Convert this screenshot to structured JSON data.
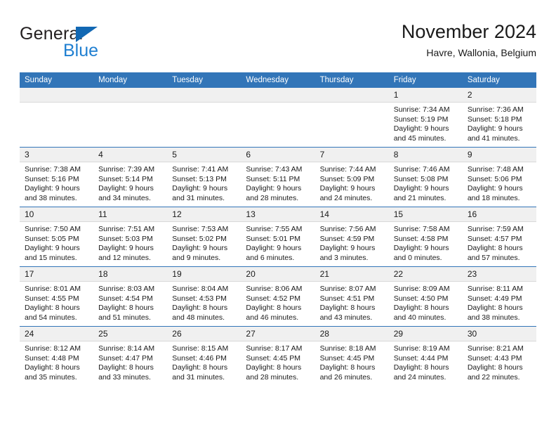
{
  "brand": {
    "name_part1": "General",
    "name_part2": "Blue",
    "triangle_color": "#1268b3",
    "blue_color": "#1f7fd1"
  },
  "header": {
    "title": "November 2024",
    "subtitle": "Havre, Wallonia, Belgium",
    "header_bg": "#3275b8",
    "daynum_bg": "#f0f0f0"
  },
  "weekdays": [
    "Sunday",
    "Monday",
    "Tuesday",
    "Wednesday",
    "Thursday",
    "Friday",
    "Saturday"
  ],
  "weeks": [
    [
      {
        "day": "",
        "empty": true
      },
      {
        "day": "",
        "empty": true
      },
      {
        "day": "",
        "empty": true
      },
      {
        "day": "",
        "empty": true
      },
      {
        "day": "",
        "empty": true
      },
      {
        "day": "1",
        "sunrise": "Sunrise: 7:34 AM",
        "sunset": "Sunset: 5:19 PM",
        "daylight1": "Daylight: 9 hours",
        "daylight2": "and 45 minutes."
      },
      {
        "day": "2",
        "sunrise": "Sunrise: 7:36 AM",
        "sunset": "Sunset: 5:18 PM",
        "daylight1": "Daylight: 9 hours",
        "daylight2": "and 41 minutes."
      }
    ],
    [
      {
        "day": "3",
        "sunrise": "Sunrise: 7:38 AM",
        "sunset": "Sunset: 5:16 PM",
        "daylight1": "Daylight: 9 hours",
        "daylight2": "and 38 minutes."
      },
      {
        "day": "4",
        "sunrise": "Sunrise: 7:39 AM",
        "sunset": "Sunset: 5:14 PM",
        "daylight1": "Daylight: 9 hours",
        "daylight2": "and 34 minutes."
      },
      {
        "day": "5",
        "sunrise": "Sunrise: 7:41 AM",
        "sunset": "Sunset: 5:13 PM",
        "daylight1": "Daylight: 9 hours",
        "daylight2": "and 31 minutes."
      },
      {
        "day": "6",
        "sunrise": "Sunrise: 7:43 AM",
        "sunset": "Sunset: 5:11 PM",
        "daylight1": "Daylight: 9 hours",
        "daylight2": "and 28 minutes."
      },
      {
        "day": "7",
        "sunrise": "Sunrise: 7:44 AM",
        "sunset": "Sunset: 5:09 PM",
        "daylight1": "Daylight: 9 hours",
        "daylight2": "and 24 minutes."
      },
      {
        "day": "8",
        "sunrise": "Sunrise: 7:46 AM",
        "sunset": "Sunset: 5:08 PM",
        "daylight1": "Daylight: 9 hours",
        "daylight2": "and 21 minutes."
      },
      {
        "day": "9",
        "sunrise": "Sunrise: 7:48 AM",
        "sunset": "Sunset: 5:06 PM",
        "daylight1": "Daylight: 9 hours",
        "daylight2": "and 18 minutes."
      }
    ],
    [
      {
        "day": "10",
        "sunrise": "Sunrise: 7:50 AM",
        "sunset": "Sunset: 5:05 PM",
        "daylight1": "Daylight: 9 hours",
        "daylight2": "and 15 minutes."
      },
      {
        "day": "11",
        "sunrise": "Sunrise: 7:51 AM",
        "sunset": "Sunset: 5:03 PM",
        "daylight1": "Daylight: 9 hours",
        "daylight2": "and 12 minutes."
      },
      {
        "day": "12",
        "sunrise": "Sunrise: 7:53 AM",
        "sunset": "Sunset: 5:02 PM",
        "daylight1": "Daylight: 9 hours",
        "daylight2": "and 9 minutes."
      },
      {
        "day": "13",
        "sunrise": "Sunrise: 7:55 AM",
        "sunset": "Sunset: 5:01 PM",
        "daylight1": "Daylight: 9 hours",
        "daylight2": "and 6 minutes."
      },
      {
        "day": "14",
        "sunrise": "Sunrise: 7:56 AM",
        "sunset": "Sunset: 4:59 PM",
        "daylight1": "Daylight: 9 hours",
        "daylight2": "and 3 minutes."
      },
      {
        "day": "15",
        "sunrise": "Sunrise: 7:58 AM",
        "sunset": "Sunset: 4:58 PM",
        "daylight1": "Daylight: 9 hours",
        "daylight2": "and 0 minutes."
      },
      {
        "day": "16",
        "sunrise": "Sunrise: 7:59 AM",
        "sunset": "Sunset: 4:57 PM",
        "daylight1": "Daylight: 8 hours",
        "daylight2": "and 57 minutes."
      }
    ],
    [
      {
        "day": "17",
        "sunrise": "Sunrise: 8:01 AM",
        "sunset": "Sunset: 4:55 PM",
        "daylight1": "Daylight: 8 hours",
        "daylight2": "and 54 minutes."
      },
      {
        "day": "18",
        "sunrise": "Sunrise: 8:03 AM",
        "sunset": "Sunset: 4:54 PM",
        "daylight1": "Daylight: 8 hours",
        "daylight2": "and 51 minutes."
      },
      {
        "day": "19",
        "sunrise": "Sunrise: 8:04 AM",
        "sunset": "Sunset: 4:53 PM",
        "daylight1": "Daylight: 8 hours",
        "daylight2": "and 48 minutes."
      },
      {
        "day": "20",
        "sunrise": "Sunrise: 8:06 AM",
        "sunset": "Sunset: 4:52 PM",
        "daylight1": "Daylight: 8 hours",
        "daylight2": "and 46 minutes."
      },
      {
        "day": "21",
        "sunrise": "Sunrise: 8:07 AM",
        "sunset": "Sunset: 4:51 PM",
        "daylight1": "Daylight: 8 hours",
        "daylight2": "and 43 minutes."
      },
      {
        "day": "22",
        "sunrise": "Sunrise: 8:09 AM",
        "sunset": "Sunset: 4:50 PM",
        "daylight1": "Daylight: 8 hours",
        "daylight2": "and 40 minutes."
      },
      {
        "day": "23",
        "sunrise": "Sunrise: 8:11 AM",
        "sunset": "Sunset: 4:49 PM",
        "daylight1": "Daylight: 8 hours",
        "daylight2": "and 38 minutes."
      }
    ],
    [
      {
        "day": "24",
        "sunrise": "Sunrise: 8:12 AM",
        "sunset": "Sunset: 4:48 PM",
        "daylight1": "Daylight: 8 hours",
        "daylight2": "and 35 minutes."
      },
      {
        "day": "25",
        "sunrise": "Sunrise: 8:14 AM",
        "sunset": "Sunset: 4:47 PM",
        "daylight1": "Daylight: 8 hours",
        "daylight2": "and 33 minutes."
      },
      {
        "day": "26",
        "sunrise": "Sunrise: 8:15 AM",
        "sunset": "Sunset: 4:46 PM",
        "daylight1": "Daylight: 8 hours",
        "daylight2": "and 31 minutes."
      },
      {
        "day": "27",
        "sunrise": "Sunrise: 8:17 AM",
        "sunset": "Sunset: 4:45 PM",
        "daylight1": "Daylight: 8 hours",
        "daylight2": "and 28 minutes."
      },
      {
        "day": "28",
        "sunrise": "Sunrise: 8:18 AM",
        "sunset": "Sunset: 4:45 PM",
        "daylight1": "Daylight: 8 hours",
        "daylight2": "and 26 minutes."
      },
      {
        "day": "29",
        "sunrise": "Sunrise: 8:19 AM",
        "sunset": "Sunset: 4:44 PM",
        "daylight1": "Daylight: 8 hours",
        "daylight2": "and 24 minutes."
      },
      {
        "day": "30",
        "sunrise": "Sunrise: 8:21 AM",
        "sunset": "Sunset: 4:43 PM",
        "daylight1": "Daylight: 8 hours",
        "daylight2": "and 22 minutes."
      }
    ]
  ]
}
